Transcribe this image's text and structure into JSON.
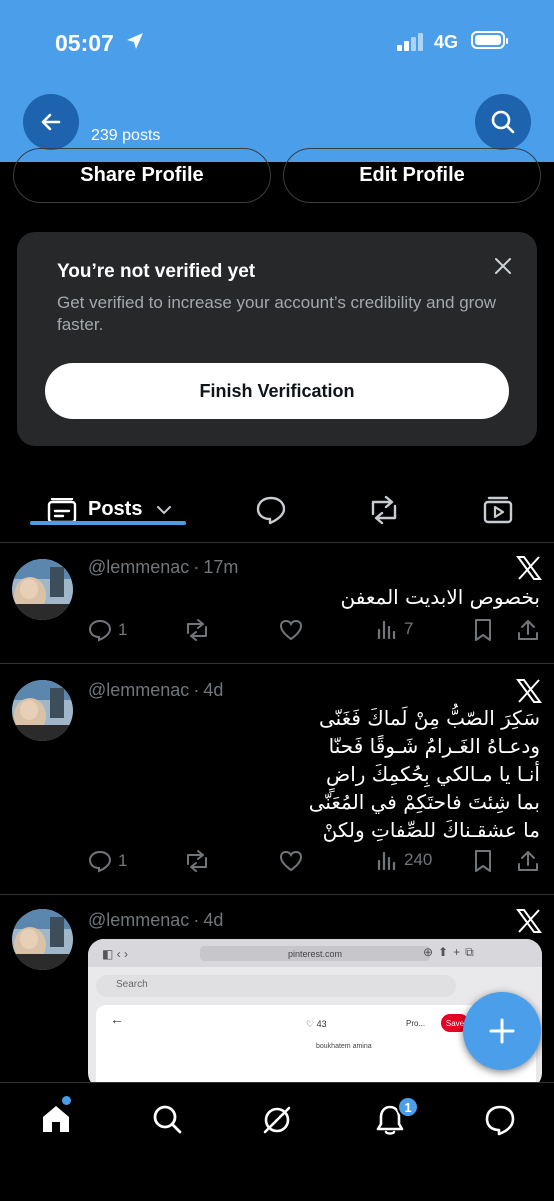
{
  "status": {
    "time": "05:07",
    "network": "4G"
  },
  "header": {
    "post_count": "239 posts"
  },
  "profile_actions": {
    "share_label": "Share Profile",
    "edit_label": "Edit Profile"
  },
  "verify": {
    "title": "You’re not verified yet",
    "description": "Get verified to increase your account’s credibility and grow faster.",
    "button": "Finish Verification"
  },
  "tabs": {
    "posts_label": "Posts"
  },
  "tweets": [
    {
      "handle": "@lemmenac",
      "sep": "·",
      "time": "17m",
      "text": "بخصوص الابديت المعفن",
      "replies": "1",
      "views": "7"
    },
    {
      "handle": "@lemmenac",
      "sep": "·",
      "time": "4d",
      "lines": [
        "سَكِرَ الصّبُّ مِنْ لَماكَ فَغَنّى",
        "ودعـاهُ الغَـرامُ شَـوقًا فَحنّا",
        "أنـا يا مـالكي بِحُكمِكَ راضٍ",
        "بما شِئتَ فاحتَكِمْ في المُعَنّى",
        "ما عشقـناكَ للصِّفاتِ ولكنْ"
      ],
      "replies": "1",
      "views": "240"
    },
    {
      "handle": "@lemmenac",
      "sep": "·",
      "time": "4d",
      "media": {
        "url": "pinterest.com",
        "search_placeholder": "Search",
        "likes": "43",
        "profile_menu": "Pro...",
        "save_label": "Save",
        "username": "boukhatem amina"
      }
    }
  ],
  "notifications": {
    "badge": "1"
  }
}
